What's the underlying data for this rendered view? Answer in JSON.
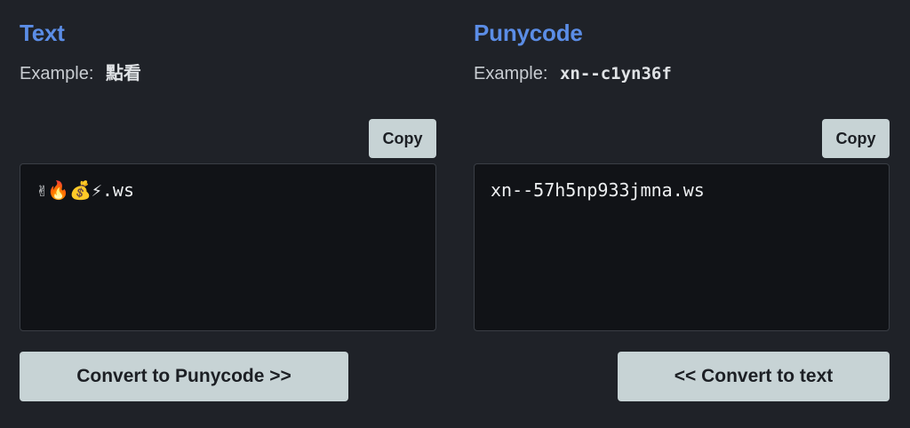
{
  "text_panel": {
    "title": "Text",
    "example_label": "Example:",
    "example_value": "點看",
    "copy_label": "Copy",
    "textbox_value": "✌🔥💰⚡.ws",
    "convert_label": "Convert to Punycode >>"
  },
  "punycode_panel": {
    "title": "Punycode",
    "example_label": "Example:",
    "example_value": "xn--c1yn36f",
    "copy_label": "Copy",
    "textbox_value": "xn--57h5np933jmna.ws",
    "convert_label": "<< Convert to text"
  },
  "colors": {
    "background": "#1f2228",
    "accent": "#5b8de6",
    "button": "#c7d3d5",
    "textbox": "#111317"
  }
}
